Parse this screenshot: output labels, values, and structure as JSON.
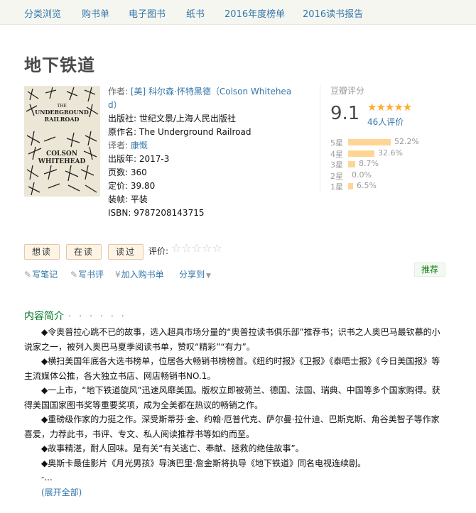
{
  "nav": {
    "items": [
      "分类浏览",
      "购书单",
      "电子图书",
      "纸书",
      "2016年度榜单",
      "2016读书报告"
    ]
  },
  "book": {
    "title": "地下铁道",
    "cover_lines": [
      "THE",
      "UNDERGROUND",
      "RAILROAD",
      "COLSON",
      "WHITEHEAD"
    ],
    "author_label": "作者:",
    "author_line1": "[美] 科尔森·怀特黑德（Colson Whitehea",
    "author_line2": "d）",
    "publisher": "出版社: 世纪文景/上海人民出版社",
    "original_title": "原作名: The Underground Railroad",
    "translator_label": "译者: ",
    "translator": "康慨",
    "pub_year": "出版年: 2017-3",
    "pages": "页数: 360",
    "price": "定价: 39.80",
    "binding": "装帧: 平装",
    "isbn": "ISBN: 9787208143715"
  },
  "rating": {
    "label": "豆瓣评分",
    "score": "9.1",
    "stars": "★★★★★",
    "count": "46人评价",
    "bars": [
      {
        "label": "5星",
        "pct_text": "52.2%",
        "pct": 52.2
      },
      {
        "label": "4星",
        "pct_text": "32.6%",
        "pct": 32.6
      },
      {
        "label": "3星",
        "pct_text": "8.7%",
        "pct": 8.7
      },
      {
        "label": "2星",
        "pct_text": "0.0%",
        "pct": 0.0
      },
      {
        "label": "1星",
        "pct_text": "6.5%",
        "pct": 6.5
      }
    ]
  },
  "actions": {
    "want_read": "想读",
    "reading": "在读",
    "read": "读过",
    "rate_label": "评价:",
    "rate_stars": "☆☆☆☆☆",
    "write_note": "写笔记",
    "write_review": "写书评",
    "add_cart": "加入购书单",
    "share": "分享到",
    "recommend": "推荐"
  },
  "intro": {
    "title": "内容简介",
    "dots": "· · · · · ·",
    "paragraphs": [
      "◆令奥普拉心跳不已的故事，选入超具市场分量的“奥普拉读书俱乐部”推荐书；识书之人奥巴马最钦慕的小说家之一，被列入奥巴马夏季阅读书单，赞叹“精彩”“有力”。",
      "◆横扫美国年底各大选书榜单，位居各大畅销书榜榜首。《纽约时报》《卫报》《泰晤士报》《今日美国报》等主流媒体公推，各大独立书店、网店畅销书NO.1。",
      "◆一上市，“地下铁道旋风”迅速风靡美国。版权立即被荷兰、德国、法国、瑞典、中国等多个国家购得。获得美国国家图书奖等重要奖项，成为全美都在热议的畅销之作。",
      "◆重磅级作家的力挺之作。深受斯蒂芬·金、约翰·厄普代克、萨尔曼·拉什迪、巴斯克斯、角谷美智子等作家喜爱，力荐此书，书评、专文、私人阅读推荐书等如约而至。",
      "◆故事精湛，耐人回味。是有关“有关逃亡、奉献、拯救的绝佳故事”。",
      "◆奥斯卡最佳影片《月光男孩》导演巴里·詹金斯将执导《地下铁道》同名电视连续剧。",
      "-..."
    ],
    "expand": "(展开全部)"
  },
  "colors": {
    "link": "#3377aa",
    "star": "#ffac2d",
    "bar": "#ffd596",
    "section_title": "#007722"
  }
}
